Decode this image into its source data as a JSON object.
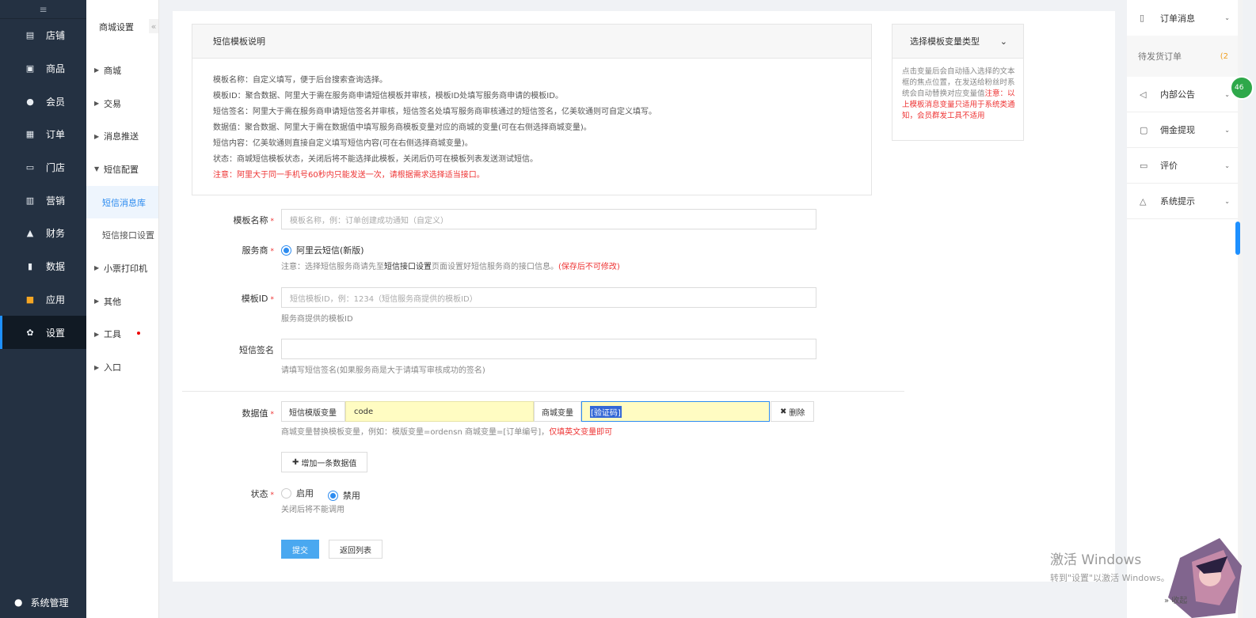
{
  "sidebar": {
    "toggle_icon": "≡",
    "items": [
      {
        "label": "店铺",
        "icon": "store-icon"
      },
      {
        "label": "商品",
        "icon": "goods-icon"
      },
      {
        "label": "会员",
        "icon": "member-icon"
      },
      {
        "label": "订单",
        "icon": "order-icon"
      },
      {
        "label": "门店",
        "icon": "shop-icon"
      },
      {
        "label": "营销",
        "icon": "gift-icon"
      },
      {
        "label": "财务",
        "icon": "finance-icon"
      },
      {
        "label": "数据",
        "icon": "chart-icon"
      },
      {
        "label": "应用",
        "icon": "apps-icon"
      },
      {
        "label": "设置",
        "icon": "gear-icon"
      }
    ],
    "bottom": "系统管理"
  },
  "subnav": {
    "title": "商城设置",
    "collapse": "«",
    "items": {
      "mall": "商城",
      "trade": "交易",
      "message_push": "消息推送",
      "sms_config": "短信配置",
      "sms_library": "短信消息库",
      "sms_interface": "短信接口设置",
      "ticket_printer": "小票打印机",
      "other": "其他",
      "tools": "工具",
      "entry": "入口"
    }
  },
  "notice": {
    "title": "短信模板说明",
    "lines": [
      "模板名称：自定义填写，便于后台搜索查询选择。",
      "模板ID：聚合数据、阿里大于需在服务商申请短信模板并审核，模板ID处填写服务商申请的模板ID。",
      "短信签名：阿里大于需在服务商申请短信签名并审核，短信签名处填写服务商审核通过的短信签名，亿美软通则可自定义填写。",
      "数据值：聚合数据、阿里大于需在数据值中填写服务商模板变量对应的商城的变量(可在右侧选择商城变量)。",
      "短信内容：亿美软通则直接自定义填写短信内容(可在右侧选择商城变量)。",
      "状态：商城短信模板状态，关闭后将不能选择此模板，关闭后仍可在模板列表发送测试短信。"
    ],
    "warning": "注意：阿里大于同一手机号60秒内只能发送一次，请根据需求选择适当接口。"
  },
  "form": {
    "template_name": {
      "label": "模板名称",
      "placeholder": "模板名称，例：订单创建成功通知（自定义）"
    },
    "provider": {
      "label": "服务商",
      "option": "阿里云短信(新版)",
      "help_prefix": "注意：选择短信服务商请先至",
      "help_link": "短信接口设置",
      "help_mid": "页面设置好短信服务商的接口信息。",
      "help_red": "(保存后不可修改)"
    },
    "template_id": {
      "label": "模板ID",
      "placeholder": "短信模板ID，例：1234（短信服务商提供的模板ID）",
      "help": "服务商提供的模板ID"
    },
    "sms_sign": {
      "label": "短信签名",
      "value": "",
      "help": "请填写短信签名(如果服务商是大于请填写审核成功的签名)"
    },
    "data_value": {
      "label": "数据值",
      "sms_var_label": "短信模版变量",
      "sms_var_value": "code",
      "mall_var_label": "商城变量",
      "mall_var_value": "[验证码]",
      "delete": "删除",
      "help": "商城变量替换模板变量，例如：模版变量=ordensn 商城变量=[订单编号]，",
      "help_red": "仅填英文变量即可",
      "add": "增加一条数据值"
    },
    "status": {
      "label": "状态",
      "opt_on": "启用",
      "opt_off": "禁用",
      "help": "关闭后将不能调用"
    },
    "submit": "提交",
    "back": "返回列表"
  },
  "var_box": {
    "title": "选择模板变量类型",
    "desc": "点击变量后会自动插入选择的文本框的焦点位置，在发送给粉丝时系统会自动替换对应变量值",
    "warn": "注意：以上模板消息变量只适用于系统类通知，会员群发工具不适用"
  },
  "right_panel": {
    "order_msg": "订单消息",
    "pending": "待发货订单",
    "pending_edit": "(2",
    "internal_notice": "内部公告",
    "commission": "佣金提现",
    "review": "评价",
    "system_tip": "系统提示",
    "badge": "46",
    "collapse": "» 收起"
  },
  "watermark": {
    "line1": "激活 Windows",
    "line2": "转到\"设置\"以激活 Windows。"
  },
  "colors": {
    "sidebar_bg": "#243142",
    "accent": "#2d8cf0",
    "primary_btn": "#4aa8f0",
    "highlight_input": "#fffcc2",
    "warn": "#e33"
  }
}
